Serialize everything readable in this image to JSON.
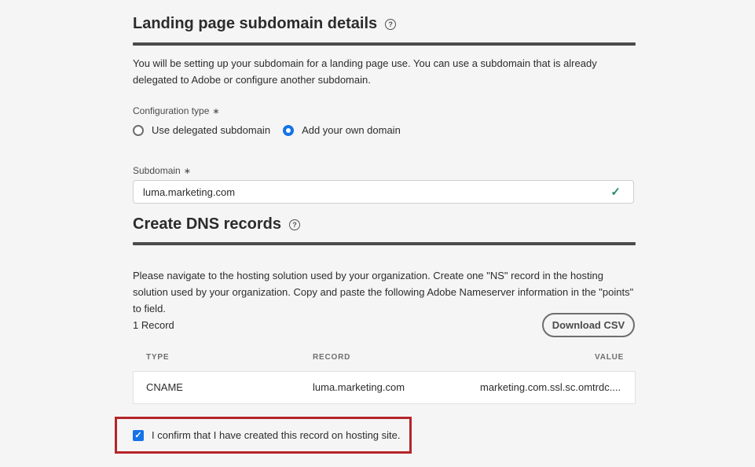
{
  "landing": {
    "title": "Landing page subdomain details",
    "help_icon": "?",
    "description": "You will be setting up your subdomain for a landing page use. You can use a subdomain that is already delegated to Adobe or configure another subdomain.",
    "config_label": "Configuration type",
    "required_mark": "∗",
    "options": [
      {
        "label": "Use delegated subdomain",
        "selected": false
      },
      {
        "label": "Add your own domain",
        "selected": true
      }
    ],
    "subdomain_label": "Subdomain",
    "subdomain_value": "luma.marketing.com",
    "valid_icon": "✓"
  },
  "dns": {
    "title": "Create DNS records",
    "help_icon": "?",
    "description": "Please navigate to the hosting solution used by your organization. Create one \"NS\" record in the hosting solution used by your organization. Copy and paste the following Adobe Nameserver information in the \"points\" to field.",
    "record_count": "1 Record",
    "download_label": "Download CSV",
    "columns": [
      "TYPE",
      "RECORD",
      "VALUE"
    ],
    "rows": [
      {
        "type": "CNAME",
        "record": "luma.marketing.com",
        "value": "marketing.com.ssl.sc.omtrdc...."
      }
    ],
    "confirm_label": "I confirm that I have created this record on hosting site.",
    "confirm_checked": true,
    "check_glyph": "✓"
  },
  "colors": {
    "accent": "#1473e6",
    "success": "#268e6c",
    "highlight": "#b5252a"
  }
}
